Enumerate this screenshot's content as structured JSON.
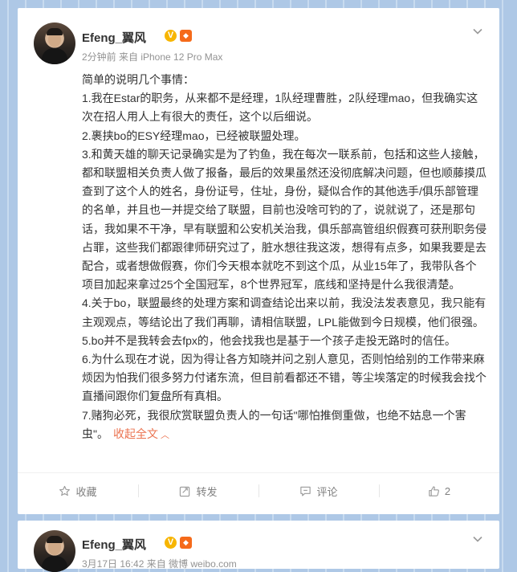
{
  "posts": [
    {
      "username": "Efeng_翼风",
      "verified_badge": "V",
      "level_badge": "◆",
      "meta": "2分钟前  来自 iPhone 12 Pro Max",
      "content": [
        "简单的说明几个事情：",
        "1.我在Estar的职务，从来都不是经理，1队经理曹胜，2队经理mao，但我确实这次在招人用人上有很大的责任，这个以后细说。",
        "2.裹挟bo的ESY经理mao，已经被联盟处理。",
        "3.和黄天雄的聊天记录确实是为了钓鱼，我在每次一联系前，包括和这些人接触，都和联盟相关负责人做了报备，最后的效果虽然还没彻底解决问题，但也顺藤摸瓜查到了这个人的姓名，身份证号，住址，身份，疑似合作的其他选手/俱乐部管理的名单，并且也一并提交给了联盟，目前也没啥可钓的了，说就说了，还是那句话，我如果不干净，早有联盟和公安机关治我，俱乐部高管组织假赛可获刑职务侵占罪，这些我们都跟律师研究过了，脏水想往我这泼，想得有点多，如果我要是去配合，或者想做假赛，你们今天根本就吃不到这个瓜，从业15年了，我带队各个项目加起来拿过25个全国冠军，8个世界冠军，底线和坚持是什么我很清楚。",
        "4.关于bo，联盟最终的处理方案和调查结论出来以前，我没法发表意见，我只能有主观观点，等结论出了我们再聊，请相信联盟，LPL能做到今日规模，他们很强。",
        "5.bo并不是我转会去fpx的，他会找我也是基于一个孩子走投无路时的信任。",
        "6.为什么现在才说，因为得让各方知晓并问之别人意见，否则怕给别的工作带来麻烦因为怕我们很多努力付诸东流，但目前看都还不错，等尘埃落定的时候我会找个直播间跟你们复盘所有真相。",
        "7.赌狗必死，我很欣赏联盟负责人的一句话\"哪怕推倒重做，也绝不姑息一个害虫\"。"
      ],
      "collapse_label": "收起全文",
      "actions": {
        "favorite": "收藏",
        "repost": "转发",
        "comment": "评论",
        "like": "2"
      }
    },
    {
      "username": "Efeng_翼风",
      "verified_badge": "V",
      "level_badge": "◆",
      "meta": "3月17日 16:42 来自 微博 weibo.com"
    }
  ],
  "icons": {
    "chevron": "chevron-down-icon",
    "favorite": "star-icon",
    "repost": "repost-icon",
    "comment": "comment-icon",
    "like": "thumbs-up-icon"
  },
  "colors": {
    "accent": "#eb7350",
    "verified": "#f7b500"
  }
}
